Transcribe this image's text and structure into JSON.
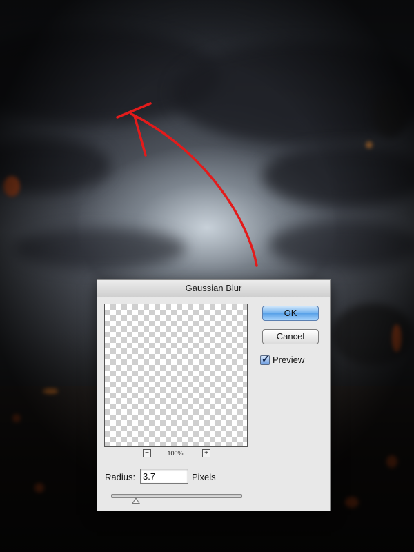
{
  "dialog": {
    "title": "Gaussian Blur",
    "ok_label": "OK",
    "cancel_label": "Cancel",
    "preview_label": "Preview",
    "preview_checked": true,
    "zoom_out_symbol": "−",
    "zoom_level": "100%",
    "zoom_in_symbol": "+",
    "radius_label": "Radius:",
    "radius_value": "3.7",
    "radius_unit": "Pixels",
    "radius_slider_fraction": 0.19
  },
  "icons": {
    "zoom_out": "minus-icon",
    "zoom_in": "plus-icon",
    "check": "checkmark-icon"
  },
  "colors": {
    "annotation": "#e31b1b",
    "ok_button": "#6fb0ee",
    "dialog_bg": "#e8e8e8"
  }
}
